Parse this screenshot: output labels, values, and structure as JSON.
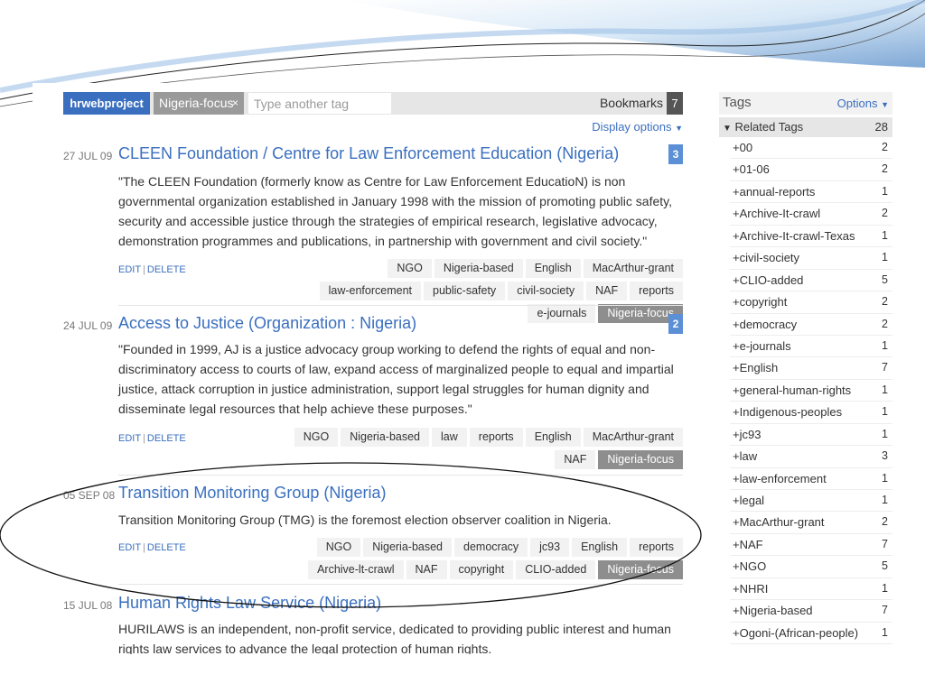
{
  "tagbar": {
    "user": "hrwebproject",
    "active_tag": "Nigeria-focus",
    "remove_icon": "×",
    "input_placeholder": "Type another tag",
    "bookmarks_label": "Bookmarks",
    "bookmarks_count": "7"
  },
  "display_options": "Display options",
  "colors": {
    "link": "#3a6fbf",
    "count_badge": "#5b8fd6",
    "active_tag": "#8e8e8e"
  },
  "icons": {
    "dropdown": "triangle-down-icon",
    "remove": "close-icon",
    "expand": "plus-icon"
  },
  "posts": [
    {
      "date": "27 JUL 09",
      "title": "CLEEN Foundation / Centre for Law Enforcement Education (Nigeria)",
      "count": "3",
      "desc": "\"The CLEEN Foundation (formerly know as Centre for Law Enforcement EducatioN) is non governmental organization established in January 1998 with the mission of promoting public safety, security and accessible justice through the strategies of empirical research, legislative advocacy, demonstration programmes and publications, in partnership with government and civil society.\"",
      "edit": "EDIT",
      "delete": "DELETE",
      "tags": [
        "NGO",
        "Nigeria-based",
        "English",
        "MacArthur-grant",
        "law-enforcement",
        "public-safety",
        "civil-society",
        "NAF",
        "reports",
        "e-journals",
        "Nigeria-focus"
      ]
    },
    {
      "date": "24 JUL 09",
      "title": "Access to Justice (Organization : Nigeria)",
      "count": "2",
      "desc": "\"Founded in 1999, AJ is a justice advocacy group working to defend the rights of equal and non-discriminatory access to courts of law, expand access of marginalized people to equal and impartial justice, attack corruption in justice administration, support legal struggles for human dignity and disseminate legal resources that help achieve these purposes.\"",
      "edit": "EDIT",
      "delete": "DELETE",
      "tags": [
        "NGO",
        "Nigeria-based",
        "law",
        "reports",
        "English",
        "MacArthur-grant",
        "NAF",
        "Nigeria-focus"
      ]
    },
    {
      "date": "05 SEP 08",
      "title": "Transition Monitoring Group (Nigeria)",
      "count": "",
      "desc": "Transition Monitoring Group (TMG) is the foremost election observer coalition in Nigeria.",
      "edit": "EDIT",
      "delete": "DELETE",
      "tags": [
        "NGO",
        "Nigeria-based",
        "democracy",
        "jc93",
        "English",
        "reports",
        "Archive-lt-crawl",
        "NAF",
        "copyright",
        "CLIO-added",
        "Nigeria-focus"
      ]
    },
    {
      "date": "15 JUL 08",
      "title": "Human Rights Law Service (Nigeria)",
      "count": "",
      "desc": "HURILAWS is an independent, non-profit service, dedicated to providing public interest and human rights law services to advance the legal protection of human rights.",
      "edit": "",
      "delete": "",
      "tags": []
    }
  ],
  "sidebar": {
    "title": "Tags",
    "options": "Options",
    "related_label": "Related Tags",
    "related_count": "28",
    "tags": [
      {
        "name": "00",
        "count": "2"
      },
      {
        "name": "01-06",
        "count": "2"
      },
      {
        "name": "annual-reports",
        "count": "1"
      },
      {
        "name": "Archive-It-crawl",
        "count": "2"
      },
      {
        "name": "Archive-It-crawl-Texas",
        "count": "1"
      },
      {
        "name": "civil-society",
        "count": "1"
      },
      {
        "name": "CLIO-added",
        "count": "5"
      },
      {
        "name": "copyright",
        "count": "2"
      },
      {
        "name": "democracy",
        "count": "2"
      },
      {
        "name": "e-journals",
        "count": "1"
      },
      {
        "name": "English",
        "count": "7"
      },
      {
        "name": "general-human-rights",
        "count": "1"
      },
      {
        "name": "Indigenous-peoples",
        "count": "1"
      },
      {
        "name": "jc93",
        "count": "1"
      },
      {
        "name": "law",
        "count": "3"
      },
      {
        "name": "law-enforcement",
        "count": "1"
      },
      {
        "name": "legal",
        "count": "1"
      },
      {
        "name": "MacArthur-grant",
        "count": "2"
      },
      {
        "name": "NAF",
        "count": "7"
      },
      {
        "name": "NGO",
        "count": "5"
      },
      {
        "name": "NHRI",
        "count": "1"
      },
      {
        "name": "Nigeria-based",
        "count": "7"
      },
      {
        "name": "Ogoni-(African-people)",
        "count": "1"
      }
    ]
  }
}
